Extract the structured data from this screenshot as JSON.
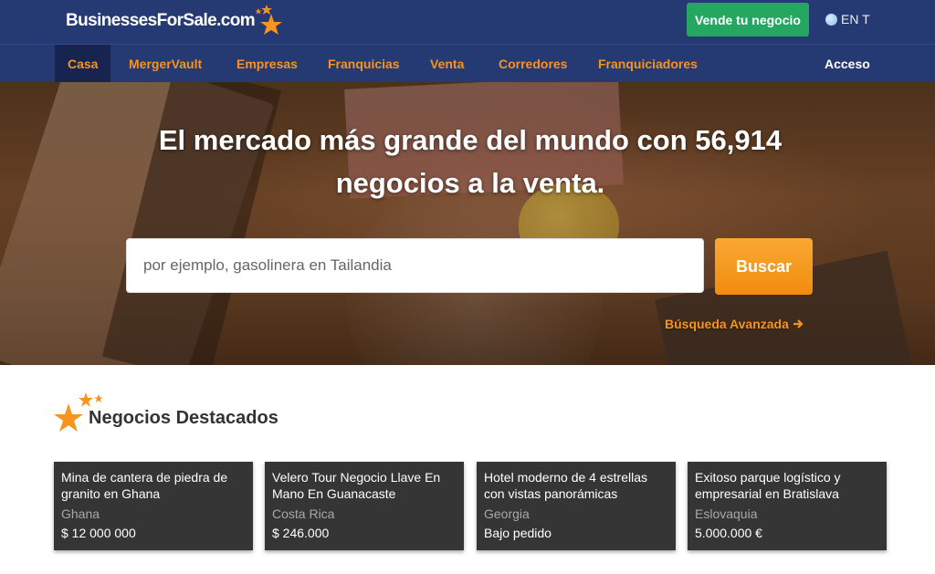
{
  "header": {
    "logo_text": "BusinessesForSale.com",
    "sell_button": "Vende tu negocio",
    "language": "EN T"
  },
  "nav": {
    "items": [
      {
        "label": "Casa",
        "active": true
      },
      {
        "label": "MergerVault"
      },
      {
        "label": "Empresas"
      },
      {
        "label": "Franquicias"
      },
      {
        "label": "Venta"
      },
      {
        "label": "Corredores"
      },
      {
        "label": "Franquiciadores"
      }
    ],
    "login": "Acceso"
  },
  "hero": {
    "title": "El mercado más grande del mundo con 56,914 negocios a la venta.",
    "search_placeholder": "por ejemplo, gasolinera en Tailandia",
    "search_button": "Buscar",
    "advanced_search": "Búsqueda Avanzada"
  },
  "featured": {
    "heading": "Negocios Destacados",
    "cards": [
      {
        "title": "Mina de cantera de piedra de granito en Ghana",
        "location": "Ghana",
        "price": "$ 12 000 000"
      },
      {
        "title": "Velero Tour Negocio Llave En Mano En Guanacaste",
        "location": "Costa Rica",
        "price": "$ 246.000"
      },
      {
        "title": "Hotel moderno de 4 estrellas con vistas panorámicas",
        "location": "Georgia",
        "price": "Bajo pedido"
      },
      {
        "title": "Exitoso parque logístico y empresarial en Bratislava",
        "location": "Eslovaquia",
        "price": "5.000.000 €"
      }
    ]
  },
  "colors": {
    "navy": "#253a73",
    "orange": "#f7941d",
    "green": "#25a762",
    "card": "#353535"
  },
  "icons": [
    "logo-stars-icon",
    "globe-icon",
    "arrow-right-icon",
    "featured-stars-icon"
  ]
}
